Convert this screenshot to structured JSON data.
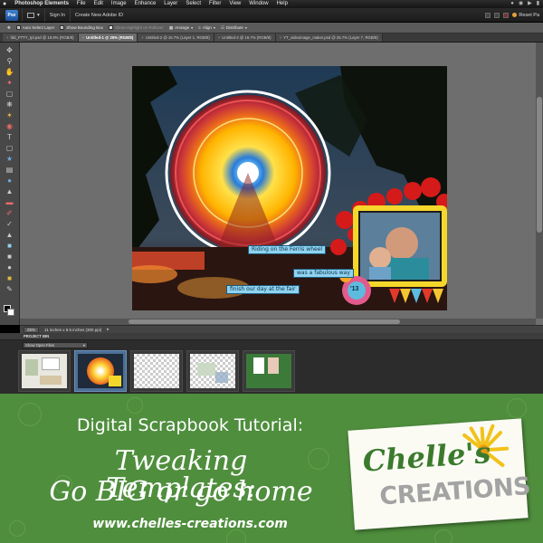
{
  "menubar": {
    "apple_icon": "apple-icon",
    "items": [
      "Photoshop Elements",
      "File",
      "Edit",
      "Image",
      "Enhance",
      "Layer",
      "Select",
      "Filter",
      "View",
      "Window",
      "Help"
    ]
  },
  "appbar": {
    "sign_in": "Sign In",
    "create_id": "Create New Adobe ID",
    "reset_panels": "Reset Pa"
  },
  "options": {
    "auto_select": "Auto Select Layer",
    "show_bounding": "Show Bounding Box",
    "show_highlight": "Show Highlight on Rollover",
    "arrange": "Arrange",
    "align": "Align",
    "distribute": "Distribute"
  },
  "tabs": [
    {
      "label": "fdd_P7TY_tpl.psd @ 19.9% (RGB/8)",
      "active": false
    },
    {
      "label": "Untitled-1 @ 25% (RGB/8)",
      "active": true
    },
    {
      "label": "Untitled-2 @ 16.7% (Layer 1, RGB/8)",
      "active": false
    },
    {
      "label": "Untitled-3 @ 16.7% (RGB/8)",
      "active": false
    },
    {
      "label": "YT_videoimage_maker.psd @ 25.7% (Layer 7, RGB/8)",
      "active": false
    }
  ],
  "photo": {
    "caption_1": "Riding on the Ferris wheel",
    "caption_2": "was a fabulous way",
    "caption_3": "finish our day at the fair",
    "badge": "'13"
  },
  "status": {
    "zoom": "25%",
    "doc_size": "11 inches x 8.5 inches (300 ppi)"
  },
  "bin": {
    "header": "PROJECT BIN",
    "dropdown": "Show Open Files"
  },
  "banner": {
    "subtitle": "Digital Scrapbook Tutorial:",
    "title_line1": "Tweaking Templates:",
    "title_line2": "Go BIG or go home",
    "url": "www.chelles-creations.com",
    "logo_name": "Chelle's",
    "logo_word": "CREATIONS"
  },
  "colors": {
    "banner_green": "#4f8e3d",
    "logo_green": "#3b7a2d",
    "caption_blue": "#8fd3f0"
  }
}
